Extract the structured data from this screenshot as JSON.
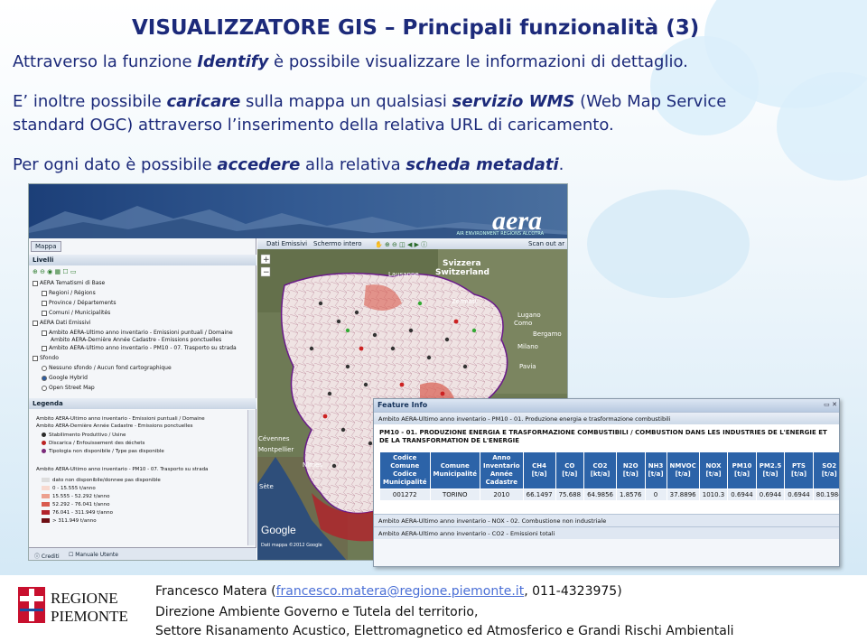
{
  "slide": {
    "title": "VISUALIZZATORE GIS – Principali funzionalità (3)",
    "line1_a": "Attraverso la funzione ",
    "line1_b": "Identify",
    "line1_c": " è possibile visualizzare le informazioni di dettaglio.",
    "line2_a": "E’ inoltre possibile ",
    "line2_b": "caricare",
    "line2_c": " sulla mappa un qualsiasi ",
    "line2_d": "servizio WMS",
    "line2_e": " (Web Map Service",
    "line3": "standard OGC) attraverso l’inserimento della relativa URL di caricamento.",
    "line4_a": "Per ogni dato è possibile ",
    "line4_b": "accedere",
    "line4_c": " alla relativa ",
    "line4_d": "scheda metadati",
    "line4_e": "."
  },
  "app": {
    "logo": "aera",
    "logo_sub": "AIR ENVIRONMENT REGIONS ALCOTRA",
    "tab_map": "Mappa",
    "panel_layers": "Livelli",
    "panel_legend": "Legenda",
    "toolbar": [
      "Dati Emissivi",
      "Schermo intero",
      "Scan out",
      "Scan out ar"
    ],
    "layers": [
      "AERA Tematismi di Base",
      "Regioni / Régions",
      "Province / Départements",
      "Comuni / Municipalités",
      "AERA Dati Emissivi",
      "Ambito AERA-Ultimo anno inventario - Emissioni puntuali / Domaine",
      "Ambito AERA-Dernière Année Cadastre - Emissions ponctuelles",
      "Ambito AERA-Ultimo anno inventario - PM10 - 07. Trasporto su strada",
      "Sfondo",
      "Nessuno sfondo / Aucun fond cartographique",
      "Google Hybrid",
      "Open Street Map"
    ],
    "legend_title1": "Ambito AERA-Ultimo anno inventario - Emissioni puntuali / Domaine",
    "legend_title1b": "Ambito AERA-Dernière Année Cadastre - Emissions ponctuelles",
    "legend_points": [
      "Stabilimento Produttivo / Usine",
      "Discarica / Enfouissement des déchets",
      "Tipologia non disponibile / Type pas disponible"
    ],
    "legend_title2": "Ambito AERA-Ultimo anno inventario - PM10 - 07. Trasporto su strada",
    "legend_classes": [
      "dato non disponibile/donnee pas disponible",
      "0 - 15.555 t/anno",
      "15.555 - 52.292 t/anno",
      "52.292 - 76.041 t/anno",
      "76.041 - 311.949 t/anno",
      "> 311.949 t/anno"
    ],
    "legend_colors": [
      "#dddddd",
      "#f8d9cf",
      "#eca08f",
      "#d95b4f",
      "#b2222b",
      "#6e0e14"
    ],
    "panel_footer": [
      "Crediti",
      "Manuale Utente"
    ],
    "map_labels": [
      "Svizzera",
      "Switzerland",
      "Lausanne",
      "Milano",
      "Bergamo",
      "Lugano",
      "Como",
      "Pavia",
      "Montpellier",
      "Nîmes",
      "Sète",
      "Cévennes",
      "Zermatt"
    ],
    "google": "Google",
    "map_credit": "Dati mappa ©2012 Google"
  },
  "feature": {
    "header": "Feature Info",
    "row1": "Ambito AERA-Ultimo anno inventario - PM10 - 01. Produzione energia e trasformazione combustibili",
    "title": "PM10 - 01. PRODUZIONE ENERGIA E TRASFORMAZIONE COMBUSTIBILI / COMBUSTION DANS LES INDUSTRIES DE L'ENERGIE ET DE LA TRANSFORMATION DE L'ENERGIE",
    "columns": [
      "Codice Comune Codice Municipalité",
      "Comune Municipalité",
      "Anno Inventario Année Cadastre",
      "CH4 [t/a]",
      "CO [t/a]",
      "CO2 [kt/a]",
      "N2O [t/a]",
      "NH3 [t/a]",
      "NMVOC [t/a]",
      "NOX [t/a]",
      "PM10 [t/a]",
      "PM2.5 [t/a]",
      "PTS [t/a]",
      "SO2 [t/a]"
    ],
    "row": [
      "001272",
      "TORINO",
      "2010",
      "66.1497",
      "75.688",
      "64.9856",
      "1.8576",
      "0",
      "37.8896",
      "1010.3",
      "0.6944",
      "0.6944",
      "0.6944",
      "80.1984"
    ],
    "row2": "Ambito AERA-Ultimo anno inventario - NOX - 02. Combustione non industriale",
    "row3": "Ambito AERA-Ultimo anno inventario - CO2 - Emissioni totali"
  },
  "footer": {
    "org1": "REGIONE",
    "org2": "PIEMONTE",
    "line1_a": "Francesco Matera (",
    "email": "francesco.matera@regione.piemonte.it",
    "line1_b": ", 011-4323975)",
    "line2": "Direzione Ambiente Governo e Tutela del territorio,",
    "line3": "Settore Risanamento Acustico, Elettromagnetico ed Atmosferico e Grandi Rischi Ambientali"
  }
}
